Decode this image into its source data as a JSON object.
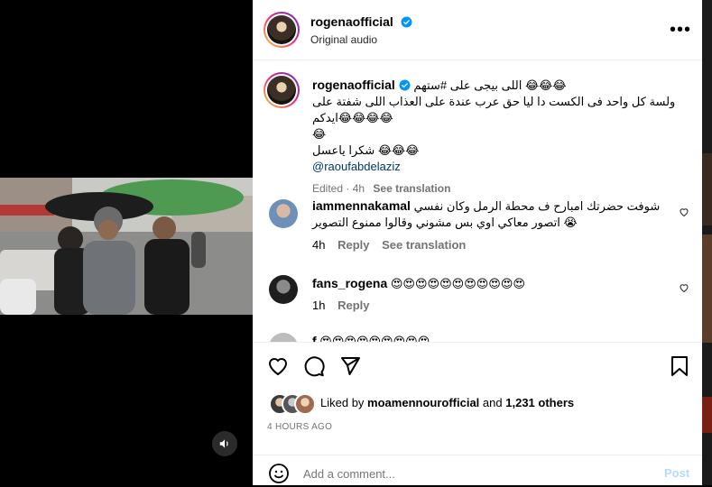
{
  "post": {
    "username": "rogenaofficial",
    "audio": "Original audio"
  },
  "caption": {
    "username": "rogenaofficial",
    "line1": "اللى بيجى على #ستهم 😂😂😂",
    "line2": "ولسة كل واحد فى الكست دا ليا حق عرب عندة على العذاب اللى شفتة على ايدكم😂😂😂😂",
    "line3": "😂",
    "line4": "شكرا ياعسل 😂😂😂",
    "mention": "@raoufabdelaziz",
    "edited": "Edited · 4h",
    "see_translation": "See translation"
  },
  "comments": [
    {
      "username": "iammennakamal",
      "text": "شوفت حضرتك امبارح ف محطة الرمل وكان نفسي اتصور معاكي اوي بس مشوني وقالوا ممنوع التصوير 😭",
      "age": "4h",
      "reply": "Reply",
      "see_translation": "See translation"
    },
    {
      "username": "fans_rogena",
      "text": "😍😍😍😍😍😍😍😍😍😍😍",
      "age": "1h",
      "reply": "Reply"
    },
    {
      "username": "f",
      "text": "😍😍😍😍😍😍😍😍😍"
    }
  ],
  "likes": {
    "prefix": "Liked by",
    "user": "moamennourofficial",
    "and": "and",
    "others": "1,231 others"
  },
  "timestamp": "4 HOURS AGO",
  "comment_box": {
    "placeholder": "Add a comment...",
    "post": "Post"
  },
  "colors": {
    "verified": "#0095f6",
    "link": "#00376b",
    "post_disabled": "#b3dbff"
  }
}
